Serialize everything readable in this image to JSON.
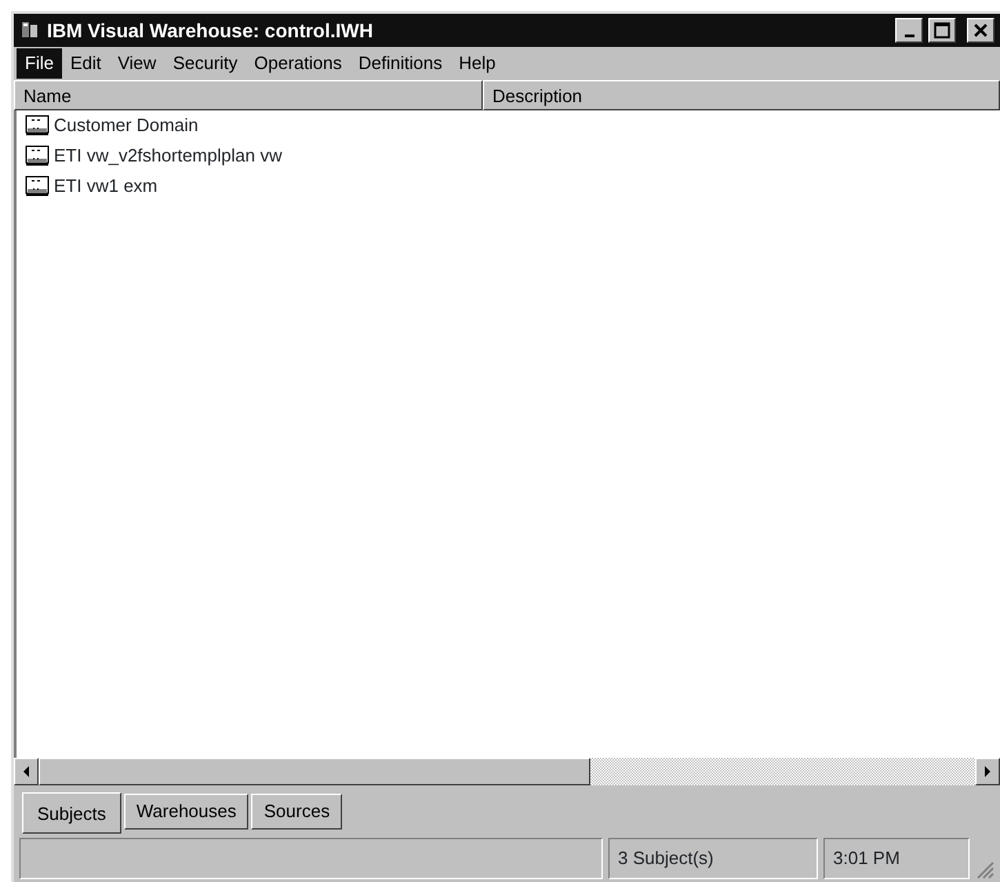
{
  "window": {
    "title": "IBM Visual Warehouse: control.IWH"
  },
  "menu": [
    {
      "label": "File",
      "selected": true
    },
    {
      "label": "Edit",
      "selected": false
    },
    {
      "label": "View",
      "selected": false
    },
    {
      "label": "Security",
      "selected": false
    },
    {
      "label": "Operations",
      "selected": false
    },
    {
      "label": "Definitions",
      "selected": false
    },
    {
      "label": "Help",
      "selected": false
    }
  ],
  "table": {
    "columns": [
      "Name",
      "Description"
    ],
    "rows": [
      {
        "name": "Customer Domain"
      },
      {
        "name": "ETI vw_v2fshortemplplan vw"
      },
      {
        "name": "ETI vw1 exm"
      }
    ]
  },
  "tabs": [
    {
      "label": "Subjects",
      "selected": true
    },
    {
      "label": "Warehouses",
      "selected": false
    },
    {
      "label": "Sources",
      "selected": false
    }
  ],
  "status_bar": {
    "count": "3 Subject(s)",
    "time": "3:01 PM"
  }
}
